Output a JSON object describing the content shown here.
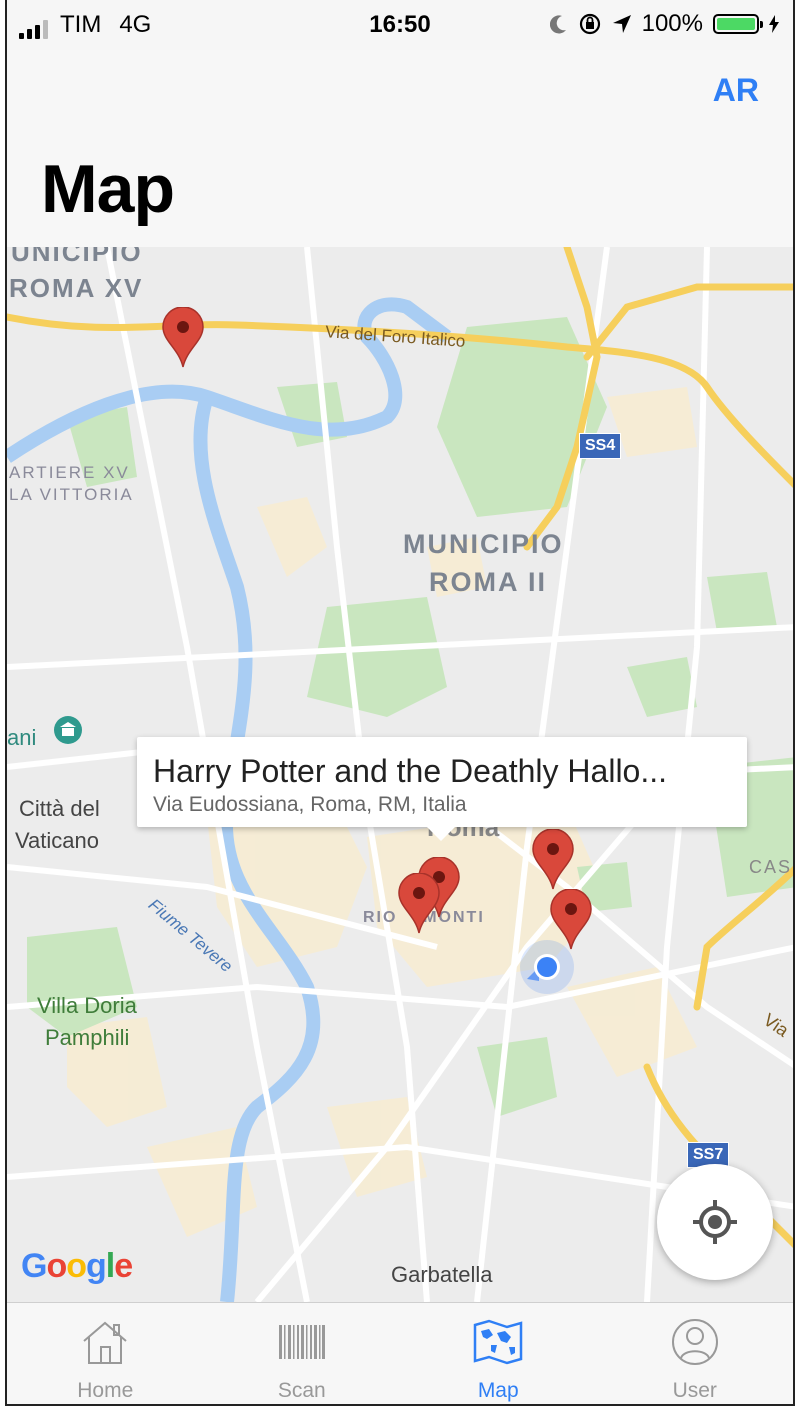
{
  "status_bar": {
    "carrier": "TIM",
    "network": "4G",
    "time": "16:50",
    "battery": "100%",
    "icons": [
      "signal-icon",
      "moon-icon",
      "rotation-lock-icon",
      "location-arrow-icon",
      "battery-icon",
      "charging-bolt-icon"
    ]
  },
  "header": {
    "title": "Map",
    "right_button": "AR"
  },
  "map": {
    "labels": {
      "municipio_xv_top": "UNICIPIO",
      "roma_xv": "ROMA XV",
      "quartiere_xv": "ARTIERE XV",
      "la_vittoria": "LA VITTORIA",
      "municipio_ii": "MUNICIPIO",
      "roma_ii": "ROMA II",
      "via_foro_italico": "Via del Foro Italico",
      "ss4": "SS4",
      "ss7": "SS7",
      "citta_del": "Città del",
      "vaticano": "Vaticano",
      "ani": "ani",
      "fiume_tevere": "Fiume Tevere",
      "rione_monti": "RIO    MONTI",
      "villa_doria": "Villa Doria",
      "pamphili": "Pamphili",
      "garbatella": "Garbatella",
      "cas": "CAS",
      "via": "Via",
      "roma_partial": "Roma"
    },
    "callout": {
      "title": "Harry Potter and the Deathly Hallo...",
      "subtitle": "Via Eudossiana, Roma, RM, Italia"
    },
    "attribution": "Google",
    "colors": {
      "pin": "#d9483b",
      "user_dot": "#3b82f6",
      "park": "#c9e6bf",
      "water": "#a9cdf3",
      "highway": "#f6cf5c"
    }
  },
  "tabbar": {
    "items": [
      {
        "label": "Home",
        "icon": "home-icon",
        "active": false
      },
      {
        "label": "Scan",
        "icon": "barcode-icon",
        "active": false
      },
      {
        "label": "Map",
        "icon": "world-map-icon",
        "active": true
      },
      {
        "label": "User",
        "icon": "user-icon",
        "active": false
      }
    ]
  }
}
